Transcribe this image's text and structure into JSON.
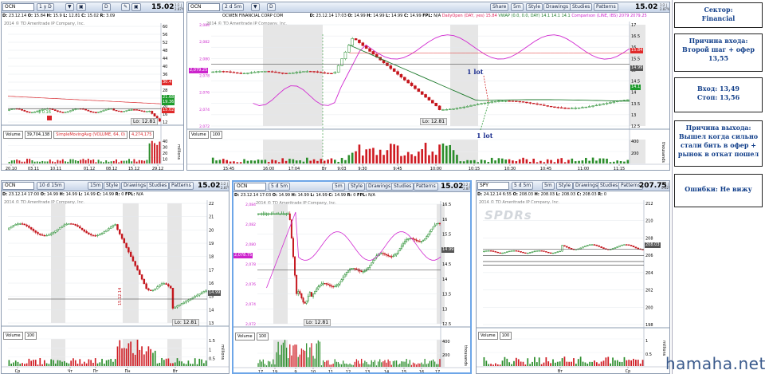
{
  "panels": [
    {
      "id": "p1",
      "symbol": "OCN",
      "timeframe": "1 y D",
      "buttons": [
        "▼",
        "▣",
        "D",
        "✎",
        "▣"
      ],
      "price": "15.02",
      "price_suffix": "1:2 | 2.87%",
      "info": [
        [
          "D:",
          "23.12.14"
        ],
        [
          "O:",
          "15.84"
        ],
        [
          "H:",
          "15.9"
        ],
        [
          "L:",
          "12.81"
        ],
        [
          "C:",
          "15.02"
        ],
        [
          "R:",
          "3.09"
        ]
      ],
      "watermark": "2014 © TD Ameritrade IP Company, Inc.",
      "low_label": "Lo: 12.81",
      "volume_title": "Volume",
      "volume_value": "39,704,138",
      "indicator": "SimpleMovingAvg (VOLUME, 64, 0)",
      "indicator_value": "4,274,175",
      "indicator_color": "#d9262b",
      "yaxis": [
        "60",
        "56",
        "52",
        "48",
        "44",
        "40",
        "36",
        "32",
        "28",
        "24",
        "20",
        "16",
        "12"
      ],
      "vol_axis": [
        "40",
        "30",
        "20",
        "10"
      ],
      "vol_unit": "millions",
      "xaxis": [
        "20.10",
        "03.11",
        "10.11",
        "01.12",
        "08.12",
        "15.12",
        "29.12"
      ],
      "tags": [
        {
          "text": "30.4",
          "color": "#e02a2a"
        },
        {
          "text": "21.68",
          "color": "#1d9b2c"
        },
        {
          "text": "19.36",
          "color": "#1d9b2c"
        },
        {
          "text": "15.02",
          "color": "#e02a2a"
        }
      ],
      "dividend": "$ 0.16"
    },
    {
      "id": "p2",
      "symbol": "OCN",
      "timeframe": "2 d 5m",
      "buttons": [
        "▼",
        "D",
        "✎",
        "▣"
      ],
      "company": "OCWEN FINANCIAL CORP COM",
      "price": "15.02",
      "price_suffix": "1:2 | 2.87%",
      "info": [
        [
          "D:",
          "23.12.14 17:03"
        ],
        [
          "O:",
          "14.99"
        ],
        [
          "H:",
          "14.99"
        ],
        [
          "L:",
          "14.99"
        ],
        [
          "C:",
          "14.99"
        ],
        [
          "FPL:",
          "N/A"
        ]
      ],
      "studies_info": [
        {
          "text": "DailyOpen (DAY, yes)",
          "color": "#e0245e"
        },
        {
          "text": "15.84",
          "color": "#e0245e"
        },
        {
          "text": "VWAP (0.0, 0.0, DAY)",
          "color": "#1d7a2c"
        },
        {
          "text": "14.1",
          "color": "#1d7a2c"
        },
        {
          "text": "14.1",
          "color": "#1d7a2c"
        },
        {
          "text": "14.1",
          "color": "#1d7a2c"
        },
        {
          "text": "Comparison (LINE, IBS)",
          "color": "#cc23cc"
        },
        {
          "text": "2079",
          "color": "#cc23cc"
        },
        {
          "text": "2079.25",
          "color": "#cc23cc"
        }
      ],
      "watermark": "2014 © TD Ameritrade IP Company, Inc.",
      "low_label": "Lo: 12.81",
      "volume_title": "Volume",
      "volume_value": "100",
      "yaxis": [
        "17",
        "16.5",
        "16",
        "15.5",
        "15",
        "14.5",
        "14",
        "13.5",
        "13",
        "12.5"
      ],
      "left_axis": [
        "2,084",
        "2,082",
        "2,080",
        "2,078",
        "2,076",
        "2,074",
        "2,072"
      ],
      "left_tag": "2,079.25",
      "vol_axis": [
        "400",
        "200"
      ],
      "vol_unit": "thousands",
      "xaxis": [
        "15:45",
        "16:00",
        "17:04",
        "Вт",
        "9:03",
        "9:30",
        "9:45",
        "10:00",
        "10:15",
        "10:30",
        "10:45",
        "11:00",
        "11:15"
      ],
      "tags": [
        {
          "text": "15.84",
          "color": "#e02a2a"
        },
        {
          "text": "14.99",
          "color": "#555555"
        },
        {
          "text": "14.1",
          "color": "#1d9b2c"
        }
      ],
      "ann_top": "1 lot",
      "ann_bottom": "1 lot"
    },
    {
      "id": "p3",
      "symbol": "OCN",
      "timeframe": "10 d 15m",
      "buttons": [
        "15m",
        "Style",
        "Drawings",
        "Studies",
        "Patterns"
      ],
      "price": "15.02",
      "price_suffix": "1:2 | 2.87%",
      "info": [
        [
          "D:",
          "23.12.14 17:00"
        ],
        [
          "O:",
          "14.99"
        ],
        [
          "H:",
          "14.99"
        ],
        [
          "L:",
          "14.99"
        ],
        [
          "C:",
          "14.99"
        ],
        [
          "R:",
          "0"
        ],
        [
          "FPL:",
          "N/A"
        ]
      ],
      "watermark": "2014 © TD Ameritrade IP Company, Inc.",
      "low_label": "Lo: 12.81",
      "volume_title": "Volume",
      "volume_value": "100",
      "yaxis": [
        "22",
        "21",
        "20",
        "19",
        "18",
        "17",
        "16",
        "15",
        "14",
        "13"
      ],
      "vol_axis": [
        "1.5",
        "1",
        "0.5"
      ],
      "vol_unit": "millions",
      "xaxis": [
        "Ср",
        "Чт",
        "Пт",
        "Пн",
        "Вт"
      ],
      "date_tag": "15.12.14",
      "tags": [
        {
          "text": "14.99",
          "color": "#555555"
        }
      ]
    },
    {
      "id": "p4",
      "symbol": "OCN",
      "timeframe": "5 d 5m",
      "buttons": [
        "5m",
        "Style",
        "Drawings",
        "Studies",
        "Patterns"
      ],
      "price": "15.02",
      "price_suffix": "1:2 | 2.87%",
      "info": [
        [
          "D:",
          "23.12.14 17:03"
        ],
        [
          "O:",
          "14.99"
        ],
        [
          "H:",
          "14.99"
        ],
        [
          "L:",
          "14.99"
        ],
        [
          "C:",
          "14.99"
        ],
        [
          "R:",
          "0"
        ],
        [
          "FPL:",
          "N/A"
        ]
      ],
      "watermark": "2014 © TD Ameritrade IP Company, Inc.",
      "low_label": "Lo: 12.81",
      "volume_title": "Volume",
      "volume_value": "100",
      "yaxis": [
        "16.5",
        "16",
        "15.5",
        "15",
        "14.5",
        "14",
        "13.5",
        "13",
        "12.5"
      ],
      "left_axis": [
        "2,084",
        "2,082",
        "2,080",
        "2,078",
        "2,076",
        "2,074",
        "2,072"
      ],
      "left_tag": "2,078.75",
      "vol_axis": [
        "400",
        "200"
      ],
      "vol_unit": "thousands",
      "xaxis": [
        "17",
        "19",
        "9",
        "10",
        "11",
        "12",
        "13",
        "14",
        "15",
        "16",
        "17"
      ],
      "tags": [
        {
          "text": "14.99",
          "color": "#555555"
        }
      ]
    },
    {
      "id": "p5",
      "symbol": "SPY",
      "timeframe": "5 d 5m",
      "buttons": [
        "5m",
        "Style",
        "Drawings",
        "Studies",
        "Patterns"
      ],
      "price": "207.75",
      "price_suffix": "1:2 | 0.02%",
      "info": [
        [
          "D:",
          "24.12.14 6:55"
        ],
        [
          "O:",
          "208.03"
        ],
        [
          "H:",
          "208.03"
        ],
        [
          "L:",
          "208.03"
        ],
        [
          "C:",
          "208.03"
        ],
        [
          "R:",
          "0"
        ]
      ],
      "watermark": "2014 © TD Ameritrade IP Company, Inc.",
      "logo": "SPDRs",
      "volume_title": "Volume",
      "volume_value": "100",
      "yaxis": [
        "212",
        "210",
        "208",
        "206",
        "204",
        "202",
        "200",
        "198"
      ],
      "vol_axis": [
        "1",
        "0.5"
      ],
      "vol_unit": "millions",
      "xaxis": [
        "Вт",
        "Ср"
      ],
      "tags": [
        {
          "text": "208.03",
          "color": "#555555"
        }
      ]
    }
  ],
  "sidebar": [
    {
      "label": "Сектор:",
      "value": "Financial"
    },
    {
      "label": "Причина входа:",
      "value": "Второй шаг + офер 13,55"
    },
    {
      "label": "Вход: 13,49",
      "value": "Стоп: 13,56"
    },
    {
      "label": "Причина выхода:",
      "value": "Вышел когда сильно стали бить в офер + рынок в откат пошел"
    },
    {
      "label": "Ошибки: Не вижу",
      "value": ""
    }
  ],
  "site": "hamaha.net",
  "colors": {
    "up": "#1e8a28",
    "down": "#c4141b",
    "comparison": "#d12ad1",
    "vwap": "#1d7a2c",
    "ma": "#d9262b",
    "volume": "#cf1b22",
    "volume_up": "#2b8d2b",
    "shade": "#e6e6e6"
  }
}
